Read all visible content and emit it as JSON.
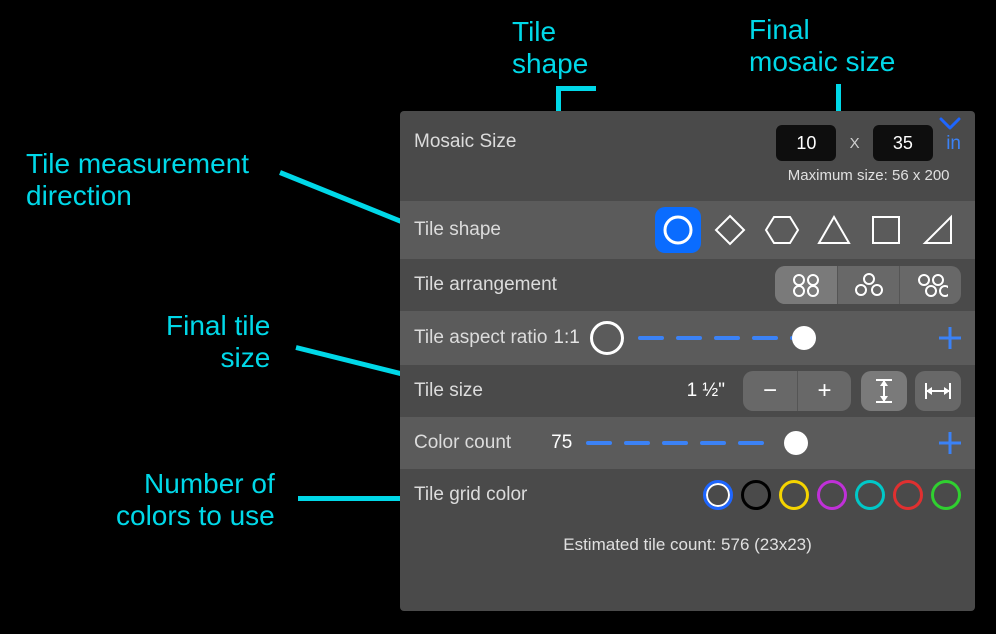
{
  "annotations": {
    "tile_shape": "Tile\nshape",
    "final_mosaic_size": "Final\nmosaic size",
    "tile_measurement_direction": "Tile measurement\ndirection",
    "final_tile_size": "Final tile\nsize",
    "number_of_colors": "Number of\ncolors to use"
  },
  "panel": {
    "mosaic_size": {
      "label": "Mosaic Size",
      "width": "10",
      "height": "35",
      "unit_label": "in",
      "max_text": "Maximum size: 56 x 200"
    },
    "tile_shape": {
      "label": "Tile shape",
      "options": [
        "circle",
        "diamond",
        "hexagon",
        "triangle",
        "square",
        "right-triangle"
      ],
      "selected": "circle"
    },
    "tile_arrangement": {
      "label": "Tile arrangement",
      "options": [
        "grid-2x2",
        "hex-honeycomb",
        "offset-2x2"
      ],
      "selected": "grid-2x2"
    },
    "aspect_ratio": {
      "label": "Tile aspect ratio",
      "value_text": "1:1",
      "slider_percent": 58
    },
    "tile_size": {
      "label": "Tile size",
      "value_text": "1 ½\"",
      "direction_selected": "vertical",
      "direction_options": [
        "vertical",
        "horizontal"
      ]
    },
    "color_count": {
      "label": "Color count",
      "value": "75",
      "slider_percent": 62
    },
    "grid_color": {
      "label": "Tile grid color",
      "swatches": [
        "#1e66ff",
        "#000000",
        "#f5d400",
        "#c030d8",
        "#00c8c8",
        "#e03030",
        "#30d030"
      ],
      "selected_index": 0
    },
    "estimate_text": "Estimated tile count: 576 (23x23)"
  }
}
